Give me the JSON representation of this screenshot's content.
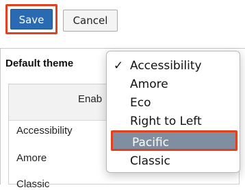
{
  "toolbar": {
    "save_label": "Save",
    "cancel_label": "Cancel"
  },
  "theme": {
    "label": "Default theme"
  },
  "enabled": {
    "title": "Enab",
    "rows": [
      "Accessibility",
      "Amore",
      "Classic"
    ]
  },
  "dropdown": {
    "checkmark": "✓",
    "items": [
      "Accessibility",
      "Amore",
      "Eco",
      "Right to Left",
      "Pacific",
      "Classic"
    ],
    "selected_index": 0,
    "highlighted_index": 4
  },
  "colors": {
    "save_bg": "#2a6ab3",
    "highlight_bg": "#7f8ea0",
    "annotation_border": "#e0411e"
  }
}
